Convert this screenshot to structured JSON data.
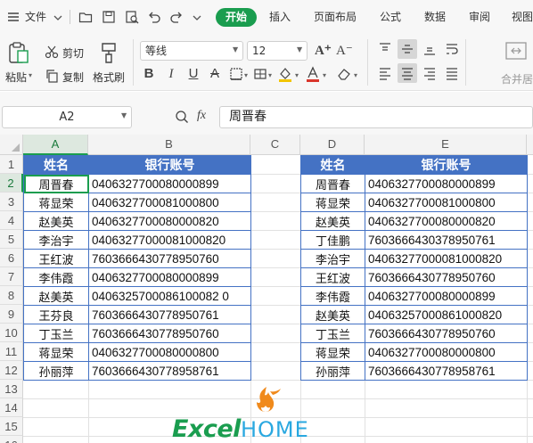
{
  "menubar": {
    "file_label": "文件",
    "tabs": [
      "开始",
      "插入",
      "页面布局",
      "公式",
      "数据",
      "审阅",
      "视图"
    ],
    "active_tab": "开始"
  },
  "ribbon": {
    "paste_label": "粘贴",
    "cut_label": "剪切",
    "copy_label": "复制",
    "format_painter_label": "格式刷",
    "font_name": "等线",
    "font_size": "12",
    "merge_label": "合并居"
  },
  "formula_bar": {
    "cell_ref": "A2",
    "fx_label": "fx",
    "content": "周晋春"
  },
  "sheet": {
    "columns": [
      "A",
      "B",
      "C",
      "D",
      "E"
    ],
    "selected_column": "A",
    "rows": [
      "1",
      "2",
      "3",
      "4",
      "5",
      "6",
      "7",
      "8",
      "9",
      "10",
      "11",
      "12",
      "13",
      "14",
      "15",
      "16"
    ],
    "selected_row": "2",
    "left_table": {
      "headers": [
        "姓名",
        "银行账号"
      ],
      "rows": [
        [
          "周晋春",
          "0406327700080000899"
        ],
        [
          "蒋显荣",
          "0406327700081000800"
        ],
        [
          "赵美英",
          "0406327700080000820"
        ],
        [
          "李治宇",
          "04063277000081000820"
        ],
        [
          "王红波",
          "7603666430778950760"
        ],
        [
          "李伟霞",
          "0406327700080000899"
        ],
        [
          "赵美英",
          "0406325700086100082 0"
        ],
        [
          "王芬良",
          "7603666430778950761"
        ],
        [
          "丁玉兰",
          "7603666430778950760"
        ],
        [
          "蒋显荣",
          "0406327700080000800"
        ],
        [
          "孙丽萍",
          "7603666430778958761"
        ]
      ]
    },
    "right_table": {
      "headers": [
        "姓名",
        "银行账号"
      ],
      "rows": [
        [
          "周晋春",
          "0406327700080000899"
        ],
        [
          "蒋显荣",
          "0406327700081000800"
        ],
        [
          "赵美英",
          "0406327700080000820"
        ],
        [
          "丁佳鹏",
          "7603666430378950761"
        ],
        [
          "李治宇",
          "04063277000081000820"
        ],
        [
          "王红波",
          "7603666430778950760"
        ],
        [
          "李伟霞",
          "0406327700080000899"
        ],
        [
          "赵美英",
          "04063257000861000820"
        ],
        [
          "丁玉兰",
          "7603666430778950760"
        ],
        [
          "蒋显荣",
          "0406327700080000800"
        ],
        [
          "孙丽萍",
          "7603666430778958761"
        ]
      ]
    }
  },
  "watermark": {
    "brand_excel": "Excel",
    "brand_home": "HOME"
  },
  "colors": {
    "accent_green": "#1a9d4f",
    "table_header_blue": "#4472c4"
  }
}
